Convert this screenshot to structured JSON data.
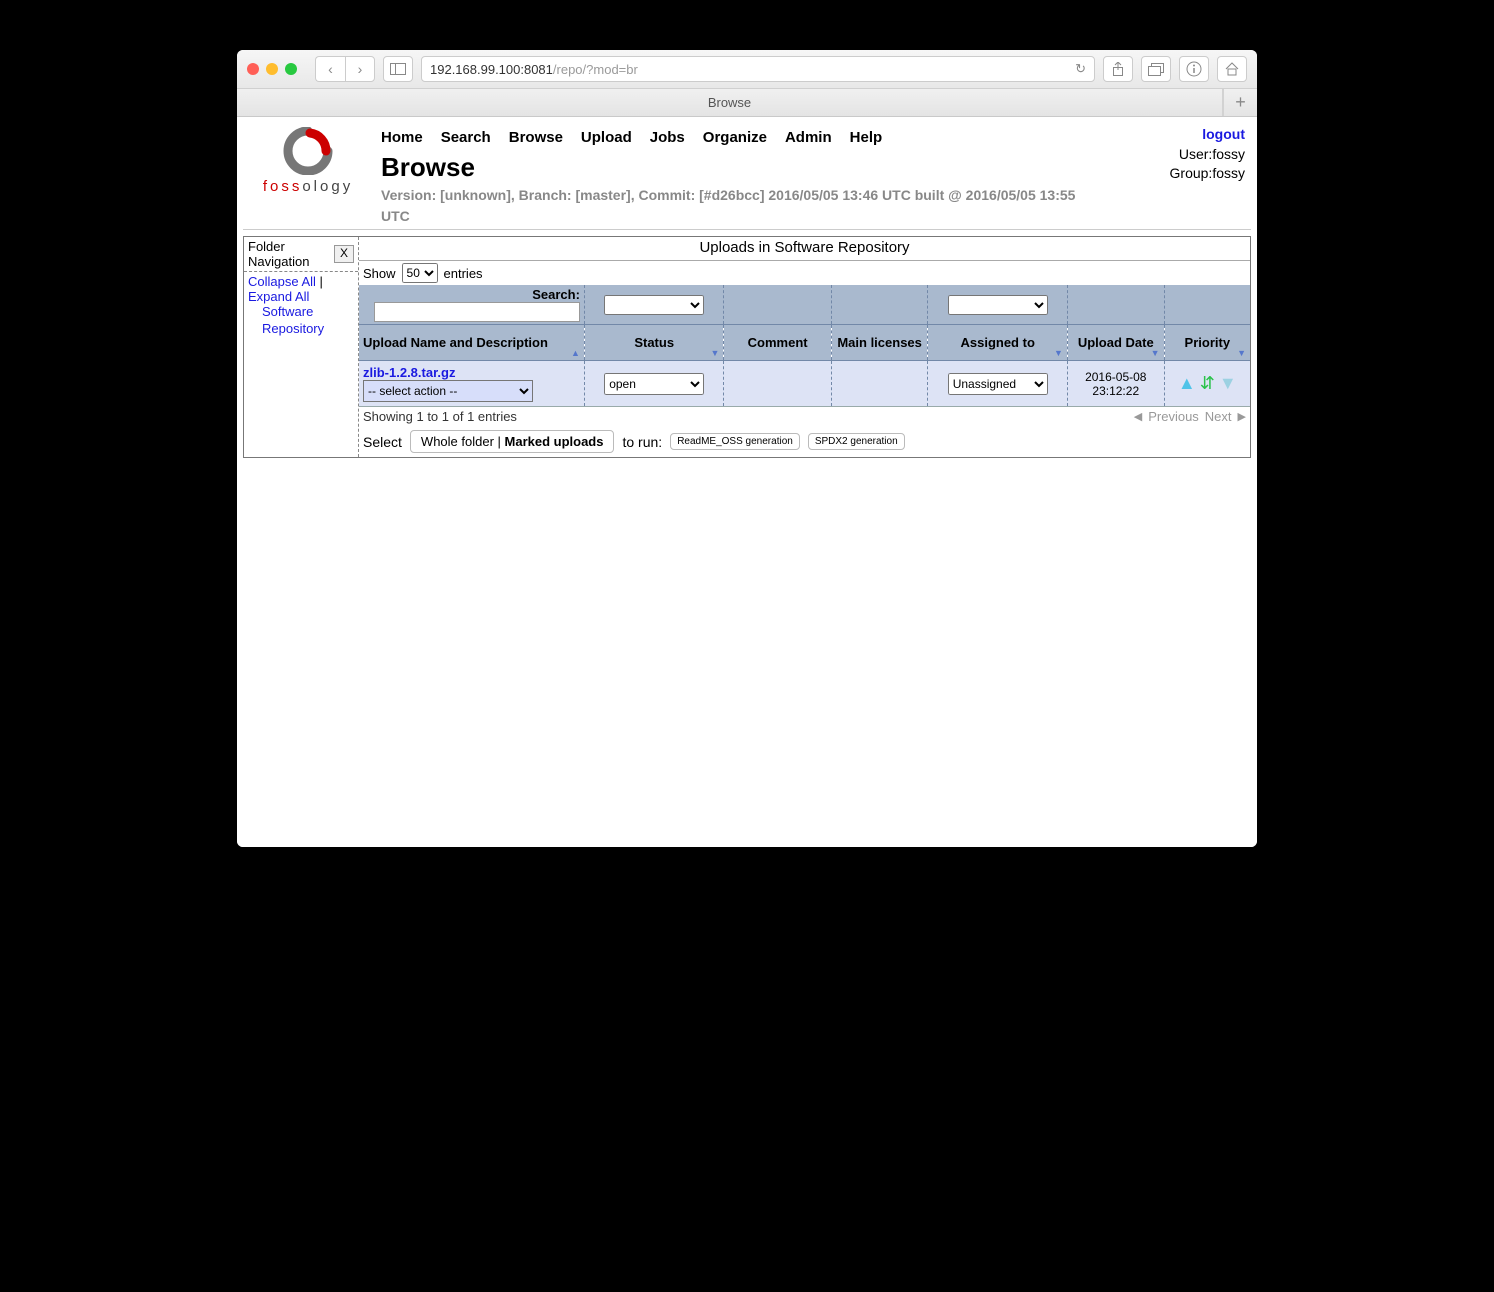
{
  "browser": {
    "url_host": "192.168.99.100:8081",
    "url_path": "/repo/?mod=br",
    "tab_title": "Browse"
  },
  "nav": {
    "items": [
      "Home",
      "Search",
      "Browse",
      "Upload",
      "Jobs",
      "Organize",
      "Admin",
      "Help"
    ]
  },
  "page": {
    "title": "Browse",
    "version": "Version: [unknown], Branch: [master], Commit: [#d26bcc] 2016/05/05 13:46 UTC built @ 2016/05/05 13:55 UTC"
  },
  "user_box": {
    "logout": "logout",
    "user": "User:fossy",
    "group": "Group:fossy"
  },
  "sidebar": {
    "title": "Folder Navigation",
    "close": "X",
    "collapse": "Collapse All",
    "expand": "Expand All",
    "tree_root": "Software Repository"
  },
  "main": {
    "title": "Uploads in Software Repository",
    "show_label": "Show",
    "show_value": "50",
    "entries_label": "entries",
    "search_label": "Search:",
    "columns": {
      "c1": "Upload Name and Description",
      "c2": "Status",
      "c3": "Comment",
      "c4": "Main licenses",
      "c5": "Assigned to",
      "c6": "Upload Date",
      "c7": "Priority"
    },
    "row": {
      "name": "zlib-1.2.8.tar.gz",
      "action": "-- select action --",
      "status": "open",
      "assigned": "Unassigned",
      "date": "2016-05-08 23:12:22"
    },
    "info": "Showing 1 to 1 of 1 entries",
    "prev": "Previous",
    "next": "Next",
    "select_label": "Select",
    "select_btn_a": "Whole folder",
    "select_btn_b": "Marked uploads",
    "to_run": "to run:",
    "run_btn_a": "ReadME_OSS generation",
    "run_btn_b": "SPDX2 generation"
  }
}
